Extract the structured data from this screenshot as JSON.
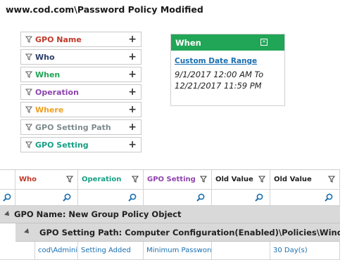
{
  "title": "www.cod.com\\Password Policy Modified",
  "colors": {
    "gpo_name": "#c0392b",
    "who": "#2c3e6a",
    "when": "#21a556",
    "operation": "#8e44ad",
    "where": "#f0a020",
    "gpo_setting_path": "#7f8c8d",
    "gpo_setting": "#16a085",
    "link": "#1a6fb0"
  },
  "filters": [
    {
      "label": "GPO Name",
      "color": "#c0392b",
      "action": "+"
    },
    {
      "label": "Who",
      "color": "#2c3e6a",
      "action": "+"
    },
    {
      "label": "When",
      "color": "#21a556",
      "action": "+"
    },
    {
      "label": "Operation",
      "color": "#8e44ad",
      "action": "+"
    },
    {
      "label": "Where",
      "color": "#f0a020",
      "action": "+"
    },
    {
      "label": "GPO Setting Path",
      "color": "#7f8c8d",
      "action": "+"
    },
    {
      "label": "GPO Setting",
      "color": "#16a085",
      "action": "+"
    }
  ],
  "when_card": {
    "title": "When",
    "link": "Custom Date Range",
    "range_start": "9/1/2017 12:00 AM To",
    "range_end": "12/21/2017 11:59 PM"
  },
  "grid": {
    "columns": [
      {
        "label": "Who",
        "color": "#c0392b"
      },
      {
        "label": "Operation",
        "color": "#16a085"
      },
      {
        "label": "GPO Setting",
        "color": "#8e44ad"
      },
      {
        "label": "Old Value",
        "color": "#222222"
      },
      {
        "label": "Old Value",
        "color": "#222222"
      }
    ],
    "group_level1": "GPO Name: New Group Policy Object",
    "group_level2": "GPO Setting Path: Computer Configuration(Enabled)\\Policies\\Window S...",
    "rows": [
      [
        "cod\\Admini...",
        "Setting Added",
        "Minimum Password",
        "",
        "30 Day(s)"
      ]
    ]
  }
}
